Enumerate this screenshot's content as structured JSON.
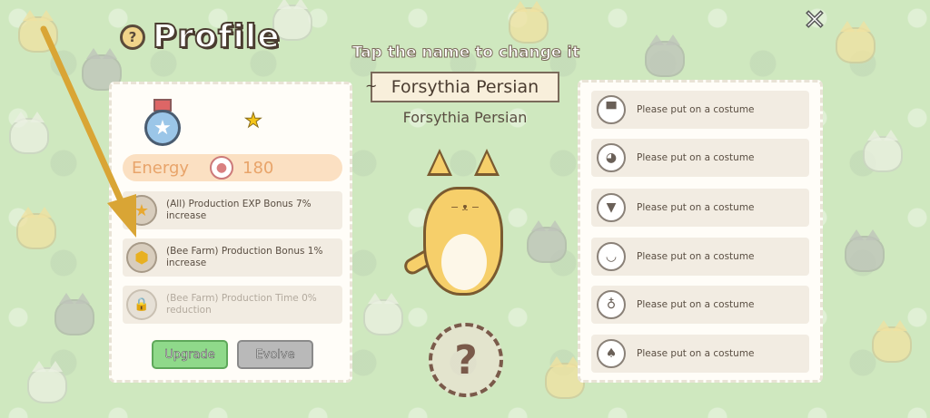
{
  "header": {
    "title": "Profile",
    "help": "?",
    "close": "✕"
  },
  "profile": {
    "energy_label": "Energy",
    "energy_value": "180",
    "bonuses": [
      {
        "text": "(All) Production EXP Bonus 7% increase",
        "icon": "star-bonus-icon",
        "glyph": "★"
      },
      {
        "text": "(Bee Farm) Production Bonus 1% increase",
        "icon": "honeycomb-icon",
        "glyph": "⬢"
      },
      {
        "text": "(Bee Farm) Production Time 0% reduction",
        "icon": "lock-icon",
        "glyph": "🔒"
      }
    ],
    "upgrade_label": "Upgrade",
    "evolve_label": "Evolve"
  },
  "cat": {
    "hint": "Tap the name to change it",
    "name": "Forsythia Persian",
    "breed": "Forsythia Persian",
    "mystery": "?"
  },
  "costumes": [
    {
      "label": "Please put on a costume",
      "icon": "hat-icon",
      "glyph": "▀"
    },
    {
      "label": "Please put on a costume",
      "icon": "cat-face-icon",
      "glyph": "◕"
    },
    {
      "label": "Please put on a costume",
      "icon": "shirt-icon",
      "glyph": "▼"
    },
    {
      "label": "Please put on a costume",
      "icon": "collar-icon",
      "glyph": "◡"
    },
    {
      "label": "Please put on a costume",
      "icon": "scooter-icon",
      "glyph": "♁"
    },
    {
      "label": "Please put on a costume",
      "icon": "bunny-icon",
      "glyph": "♠"
    }
  ],
  "colors": {
    "background": "#cfe8bf",
    "arrow": "#d9a535",
    "cat": "#f6cf6a"
  }
}
